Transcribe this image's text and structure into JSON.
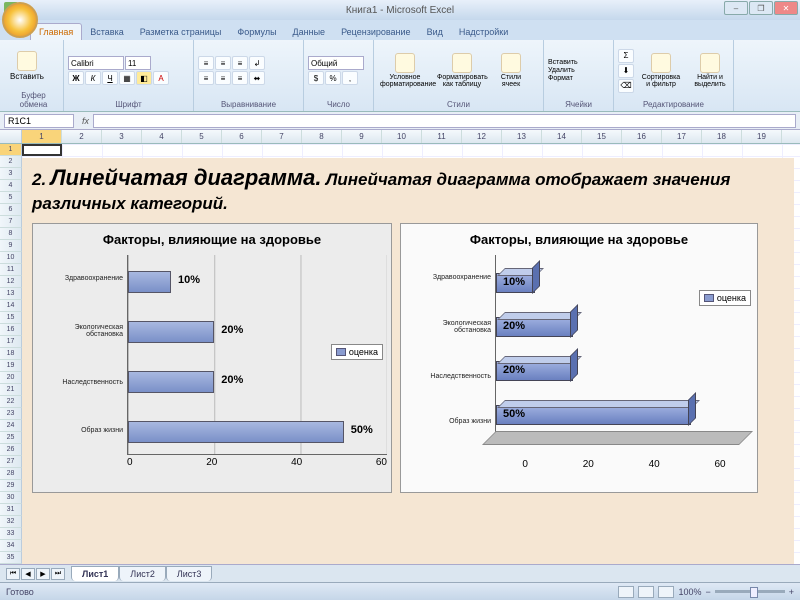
{
  "window": {
    "title": "Книга1 - Microsoft Excel"
  },
  "ribbon": {
    "tabs": [
      "Главная",
      "Вставка",
      "Разметка страницы",
      "Формулы",
      "Данные",
      "Рецензирование",
      "Вид",
      "Надстройки"
    ],
    "active_tab": "Главная",
    "groups": {
      "clipboard": {
        "label": "Буфер обмена",
        "paste": "Вставить"
      },
      "font": {
        "label": "Шрифт",
        "name": "Calibri",
        "size": "11"
      },
      "alignment": {
        "label": "Выравнивание"
      },
      "number": {
        "label": "Число",
        "format": "Общий"
      },
      "styles": {
        "label": "Стили",
        "cond": "Условное форматирование",
        "table": "Форматировать как таблицу",
        "cellst": "Стили ячеек"
      },
      "cells": {
        "label": "Ячейки",
        "insert": "Вставить",
        "delete": "Удалить",
        "format": "Формат"
      },
      "editing": {
        "label": "Редактирование",
        "sort": "Сортировка и фильтр",
        "find": "Найти и выделить"
      }
    }
  },
  "formula_bar": {
    "name_box": "R1C1",
    "fx": "fx"
  },
  "columns": [
    "1",
    "2",
    "3",
    "4",
    "5",
    "6",
    "7",
    "8",
    "9",
    "10",
    "11",
    "12",
    "13",
    "14",
    "15",
    "16",
    "17",
    "18",
    "19"
  ],
  "rows_visible": 35,
  "content": {
    "heading_num": "2.",
    "heading_main": "Линейчатая диаграмма.",
    "heading_rest": "Линейчатая диаграмма отображает значения различных категорий."
  },
  "chart_data": [
    {
      "type": "bar",
      "orientation": "horizontal",
      "title": "Факторы, влияющие на здоровье",
      "categories": [
        "Здравоохранение",
        "Экологическая обстановка",
        "Наследственность",
        "Образ жизни"
      ],
      "values": [
        10,
        20,
        20,
        50
      ],
      "value_labels": [
        "10%",
        "20%",
        "20%",
        "50%"
      ],
      "x_ticks": [
        "0",
        "20",
        "40",
        "60"
      ],
      "xlim": [
        0,
        60
      ],
      "legend": "оценка",
      "style": "2d"
    },
    {
      "type": "bar",
      "orientation": "horizontal",
      "title": "Факторы, влияющие на здоровье",
      "categories": [
        "Здравоохранение",
        "Экологическая обстановка",
        "Наследственность",
        "Образ жизни"
      ],
      "values": [
        10,
        20,
        20,
        50
      ],
      "value_labels": [
        "10%",
        "20%",
        "20%",
        "50%"
      ],
      "x_ticks": [
        "0",
        "20",
        "40",
        "60"
      ],
      "xlim": [
        0,
        60
      ],
      "legend": "оценка",
      "style": "3d"
    }
  ],
  "sheet_tabs": {
    "tabs": [
      "Лист1",
      "Лист2",
      "Лист3"
    ],
    "active": "Лист1"
  },
  "statusbar": {
    "ready": "Готово",
    "zoom": "100%",
    "minus": "−",
    "plus": "+"
  }
}
